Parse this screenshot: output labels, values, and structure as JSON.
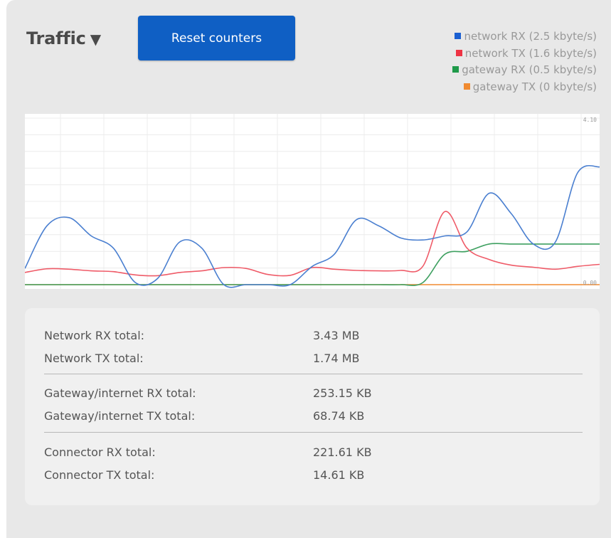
{
  "header": {
    "title": "Traffic",
    "title_caret": "▼",
    "reset_label": "Reset counters"
  },
  "legend": [
    {
      "label": "network RX (2.5 kbyte/s)",
      "color": "#1a5fd1"
    },
    {
      "label": "network TX (1.6 kbyte/s)",
      "color": "#ee3344"
    },
    {
      "label": "gateway RX (0.5 kbyte/s)",
      "color": "#1f9a4a"
    },
    {
      "label": "gateway TX (0 kbyte/s)",
      "color": "#f08a30"
    }
  ],
  "chart_data": {
    "type": "line",
    "ymax_label": "4.10",
    "ymin_label": "0.00",
    "ylim": [
      0,
      4.1
    ],
    "x": [
      0,
      1,
      2,
      3,
      4,
      5,
      6,
      7,
      8,
      9,
      10,
      11,
      12,
      13,
      14,
      15,
      16,
      17,
      18,
      19,
      20,
      21,
      22,
      23,
      24,
      25,
      26
    ],
    "series": [
      {
        "name": "network RX (2.5 kbyte/s)",
        "color": "#4a7fd0",
        "values": [
          0.4,
          1.45,
          1.65,
          1.2,
          0.9,
          0.05,
          0.15,
          1.05,
          0.9,
          0,
          0,
          0,
          0,
          0.45,
          0.75,
          1.6,
          1.45,
          1.15,
          1.1,
          1.2,
          1.3,
          2.25,
          1.75,
          1.0,
          1.05,
          2.75,
          2.9
        ]
      },
      {
        "name": "network TX (1.6 kbyte/s)",
        "color": "#ef5b68",
        "values": [
          0.3,
          0.39,
          0.38,
          0.34,
          0.32,
          0.24,
          0.22,
          0.3,
          0.34,
          0.42,
          0.4,
          0.25,
          0.23,
          0.42,
          0.38,
          0.35,
          0.34,
          0.35,
          0.45,
          1.8,
          0.9,
          0.62,
          0.48,
          0.43,
          0.38,
          0.45,
          0.5
        ]
      },
      {
        "name": "gateway RX (0.5 kbyte/s)",
        "color": "#3ea060",
        "values": [
          0,
          0,
          0,
          0,
          0,
          0,
          0,
          0,
          0,
          0,
          0,
          0,
          0,
          0,
          0,
          0,
          0,
          0,
          0.05,
          0.75,
          0.82,
          1.0,
          1.0,
          1.0,
          1.0,
          1.0,
          1.0
        ]
      },
      {
        "name": "gateway TX (0 kbyte/s)",
        "color": "#f08a30",
        "values": [
          0,
          0,
          0,
          0,
          0,
          0,
          0,
          0,
          0,
          0,
          0,
          0,
          0,
          0,
          0,
          0,
          0,
          0,
          0,
          0,
          0,
          0,
          0,
          0,
          0,
          0,
          0
        ]
      }
    ]
  },
  "stats": {
    "network": [
      {
        "label": "Network RX total:",
        "value": "3.43 MB"
      },
      {
        "label": "Network TX total:",
        "value": "1.74 MB"
      }
    ],
    "gateway": [
      {
        "label": "Gateway/internet RX total:",
        "value": "253.15 KB"
      },
      {
        "label": "Gateway/internet TX total:",
        "value": "68.74 KB"
      }
    ],
    "connector": [
      {
        "label": "Connector RX total:",
        "value": "221.61 KB"
      },
      {
        "label": "Connector TX total:",
        "value": "14.61 KB"
      }
    ]
  }
}
